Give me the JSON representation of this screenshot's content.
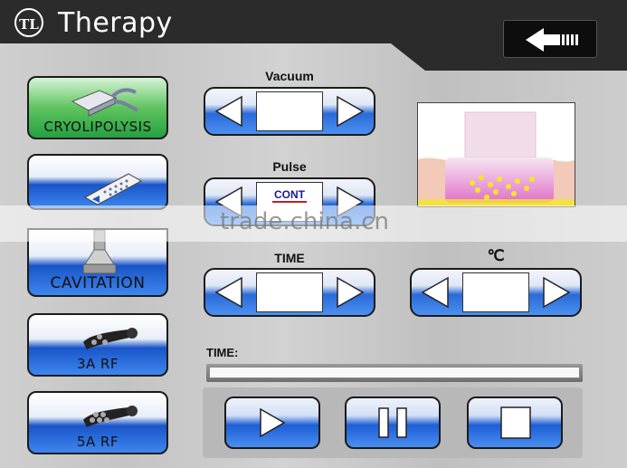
{
  "header": {
    "logo_text": "TL",
    "title": "Therapy",
    "back_icon": "back-arrow-icon"
  },
  "modes": [
    {
      "label": "CRYOLIPOLYSIS",
      "icon": "cryo-applicator-icon",
      "active": true,
      "color": "#3db34a"
    },
    {
      "label": "",
      "icon": "vacuum-handpiece-icon",
      "active": false
    },
    {
      "label": "CAVITATION",
      "icon": "cavitation-probe-icon",
      "active": false
    },
    {
      "label": "3A RF",
      "icon": "rf-handle-icon",
      "active": false
    },
    {
      "label": "5A RF",
      "icon": "rf-handle-icon",
      "active": false
    }
  ],
  "controls": {
    "vacuum": {
      "label": "Vacuum",
      "value": ""
    },
    "pulse": {
      "label": "Pulse",
      "value": "CONT"
    },
    "time": {
      "label": "TIME",
      "value": ""
    },
    "temperature": {
      "label": "℃",
      "value": ""
    }
  },
  "progress": {
    "label": "TIME:",
    "fraction": 0
  },
  "transport": {
    "play_icon": "play-icon",
    "pause_icon": "pause-icon",
    "stop_icon": "stop-icon"
  },
  "watermark": "trade.china.cn",
  "colors": {
    "accent_blue": "#2a6ad8",
    "active_green": "#3db34a",
    "header": "#2b2b2b"
  }
}
